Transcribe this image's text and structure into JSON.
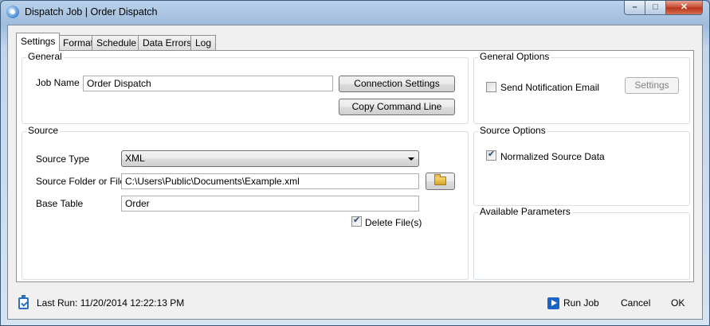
{
  "window": {
    "title": "Dispatch Job | Order Dispatch",
    "controls": {
      "minimize": "–",
      "maximize": "□",
      "close": "✕"
    }
  },
  "tabs": [
    {
      "label": "Settings",
      "active": true
    },
    {
      "label": "Format",
      "active": false
    },
    {
      "label": "Schedule",
      "active": false
    },
    {
      "label": "Data Errors",
      "active": false
    },
    {
      "label": "Log",
      "active": false
    }
  ],
  "general": {
    "title": "General",
    "job_name_label": "Job Name",
    "job_name_value": "Order Dispatch",
    "connection_settings_button": "Connection Settings",
    "copy_command_line_button": "Copy Command Line"
  },
  "source": {
    "title": "Source",
    "source_type_label": "Source Type",
    "source_type_value": "XML",
    "source_folder_label": "Source Folder or File",
    "source_folder_value": "C:\\Users\\Public\\Documents\\Example.xml",
    "base_table_label": "Base Table",
    "base_table_value": "Order",
    "delete_files_label": "Delete File(s)",
    "delete_files_checked": true
  },
  "general_options": {
    "title": "General Options",
    "send_notification_label": "Send Notification Email",
    "send_notification_checked": false,
    "settings_button": "Settings"
  },
  "source_options": {
    "title": "Source Options",
    "normalized_label": "Normalized Source Data",
    "normalized_checked": true
  },
  "available_parameters": {
    "title": "Available Parameters"
  },
  "footer": {
    "last_run": "Last Run: 11/20/2014 12:22:13 PM",
    "run_job": "Run Job",
    "cancel": "Cancel",
    "ok": "OK"
  }
}
